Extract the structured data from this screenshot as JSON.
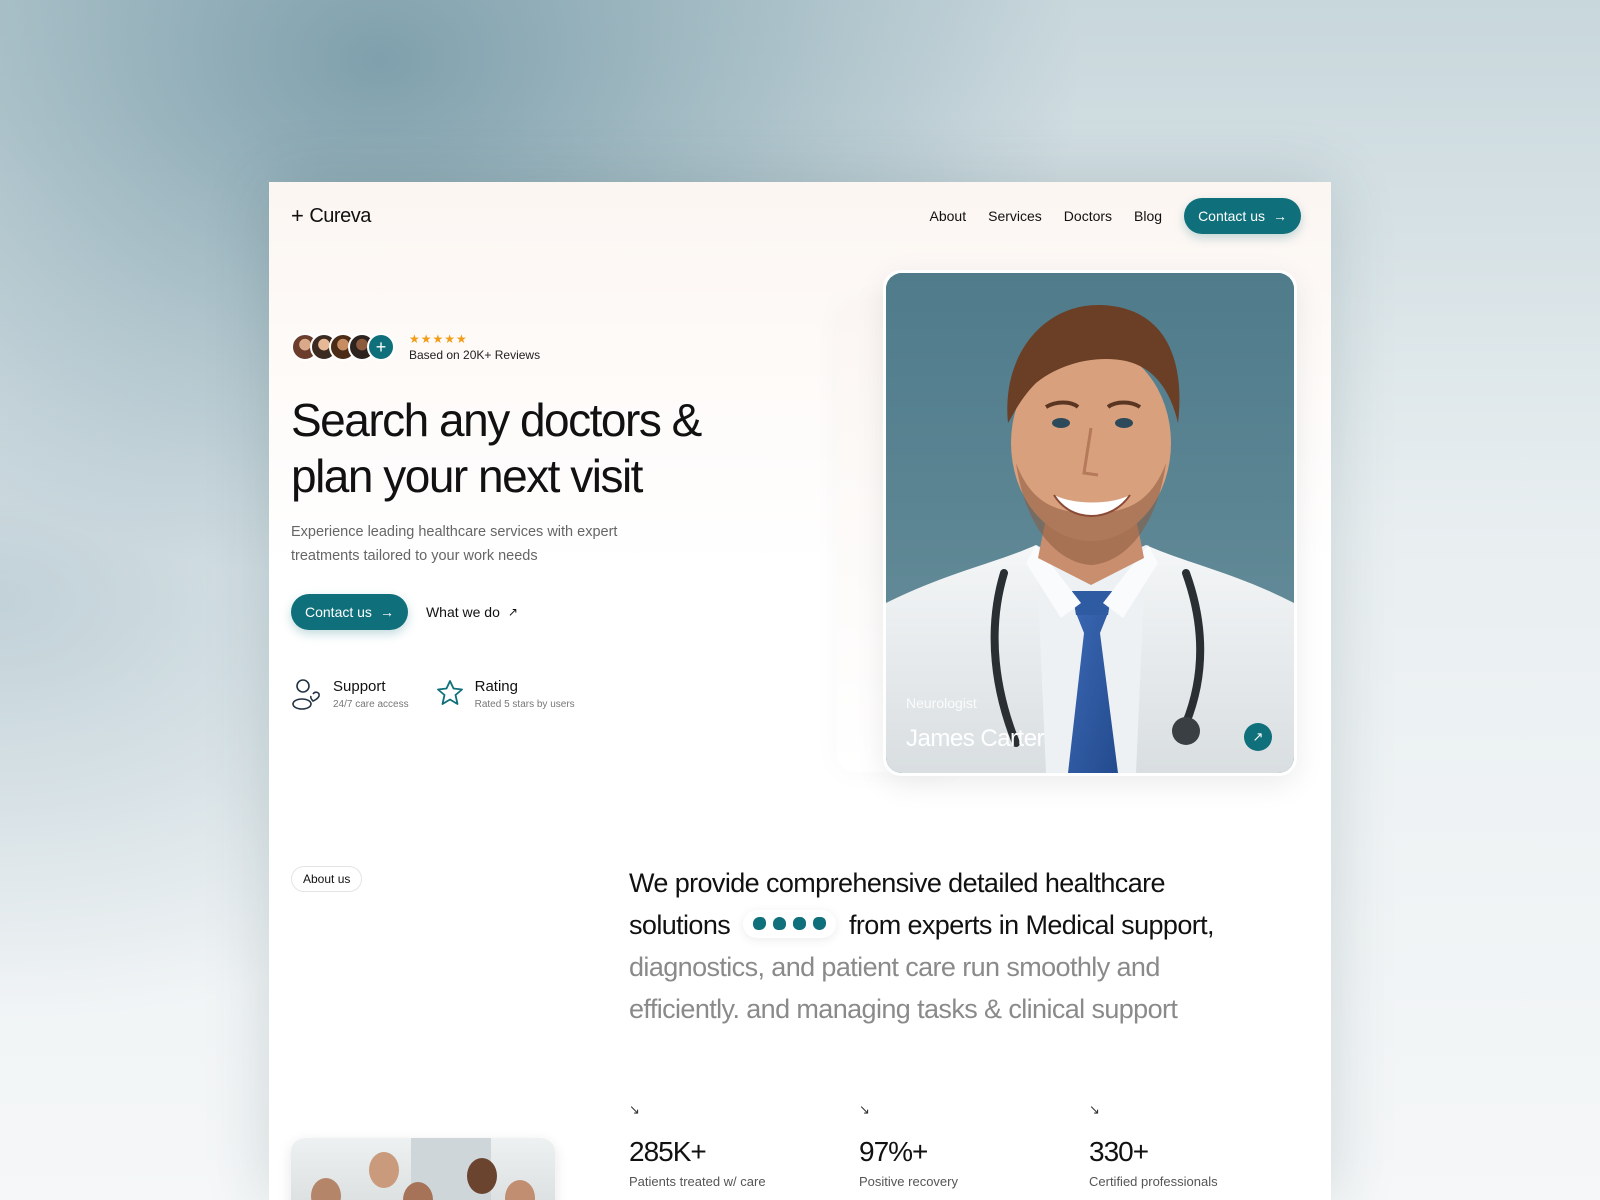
{
  "brand": {
    "name": "Cureva",
    "plus": "+"
  },
  "nav": {
    "links": [
      "About",
      "Services",
      "Doctors",
      "Blog"
    ],
    "cta": "Contact us"
  },
  "hero": {
    "stars": "★★★★★",
    "reviews_text": "Based on 20K+ Reviews",
    "title_line1": "Search any doctors &",
    "title_line2": "plan your next visit",
    "subtitle_line1": "Experience leading healthcare services with expert",
    "subtitle_line2": "treatments tailored to your work needs",
    "primary_cta": "Contact us",
    "secondary_cta": "What we do",
    "features": [
      {
        "title": "Support",
        "subtitle": "24/7 care access",
        "icon": "support-icon"
      },
      {
        "title": "Rating",
        "subtitle": "Rated 5 stars by users",
        "icon": "star-badge-icon"
      }
    ]
  },
  "doctor": {
    "role": "Neurologist",
    "name": "James Carter"
  },
  "about": {
    "pill": "About us",
    "text_part1": "We provide comprehensive detailed healthcare solutions",
    "text_part2": "from experts in Medical support,",
    "text_muted": "diagnostics, and patient care run smoothly and efficiently. and managing tasks & clinical support"
  },
  "stats": [
    {
      "value": "285K+",
      "label": "Patients treated w/ care"
    },
    {
      "value": "97%+",
      "label": "Positive recovery"
    },
    {
      "value": "330+",
      "label": "Certified professionals"
    }
  ],
  "colors": {
    "accent": "#0f6f7a",
    "star": "#f29d18"
  }
}
